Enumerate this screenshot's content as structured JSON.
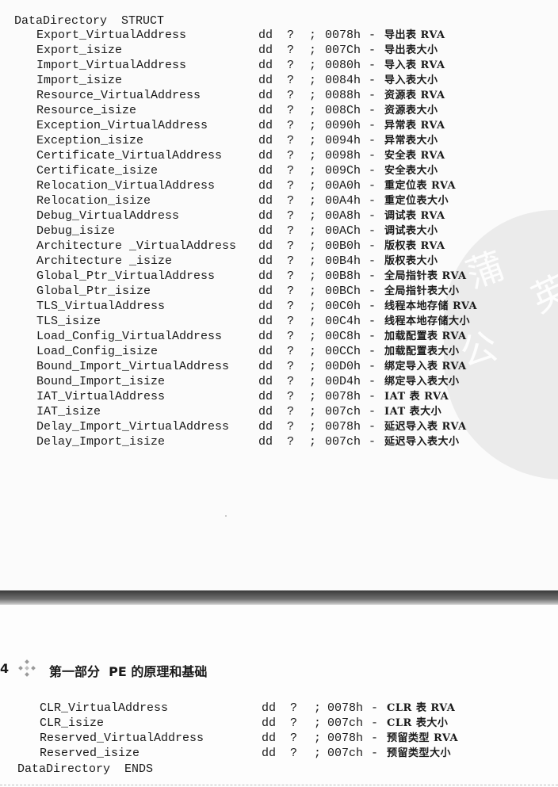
{
  "top_block": {
    "struct_open": "DataDirectory  STRUCT",
    "rows": [
      {
        "name": "Export_VirtualAddress",
        "type": "dd",
        "init": "?",
        "semi": ";",
        "offset": "0078h",
        "dash": "-",
        "comment": "导出表 RVA"
      },
      {
        "name": "Export_isize",
        "type": "dd",
        "init": "?",
        "semi": ";",
        "offset": "007Ch",
        "dash": "-",
        "comment": "导出表大小"
      },
      {
        "name": "Import_VirtualAddress",
        "type": "dd",
        "init": "?",
        "semi": ";",
        "offset": "0080h",
        "dash": "-",
        "comment": "导入表 RVA"
      },
      {
        "name": "Import_isize",
        "type": "dd",
        "init": "?",
        "semi": ";",
        "offset": "0084h",
        "dash": "-",
        "comment": "导入表大小"
      },
      {
        "name": "Resource_VirtualAddress",
        "type": "dd",
        "init": "?",
        "semi": ";",
        "offset": "0088h",
        "dash": "-",
        "comment": "资源表 RVA"
      },
      {
        "name": "Resource_isize",
        "type": "dd",
        "init": "?",
        "semi": ";",
        "offset": "008Ch",
        "dash": "-",
        "comment": "资源表大小"
      },
      {
        "name": "Exception_VirtualAddress",
        "type": "dd",
        "init": "?",
        "semi": ";",
        "offset": "0090h",
        "dash": "-",
        "comment": "异常表 RVA"
      },
      {
        "name": "Exception_isize",
        "type": "dd",
        "init": "?",
        "semi": ";",
        "offset": "0094h",
        "dash": "-",
        "comment": "异常表大小"
      },
      {
        "name": "Certificate_VirtualAddress",
        "type": "dd",
        "init": "?",
        "semi": ";",
        "offset": "0098h",
        "dash": "-",
        "comment": "安全表 RVA"
      },
      {
        "name": "Certificate_isize",
        "type": "dd",
        "init": "?",
        "semi": ";",
        "offset": "009Ch",
        "dash": "-",
        "comment": "安全表大小"
      },
      {
        "name": "Relocation_VirtualAddress",
        "type": "dd",
        "init": "?",
        "semi": ";",
        "offset": "00A0h",
        "dash": "-",
        "comment": "重定位表 RVA"
      },
      {
        "name": "Relocation_isize",
        "type": "dd",
        "init": "?",
        "semi": ";",
        "offset": "00A4h",
        "dash": "-",
        "comment": "重定位表大小"
      },
      {
        "name": "Debug_VirtualAddress",
        "type": "dd",
        "init": "?",
        "semi": ";",
        "offset": "00A8h",
        "dash": "-",
        "comment": "调试表 RVA"
      },
      {
        "name": "Debug_isize",
        "type": "dd",
        "init": "?",
        "semi": ";",
        "offset": "00ACh",
        "dash": "-",
        "comment": "调试表大小"
      },
      {
        "name": "Architecture _VirtualAddress",
        "type": "dd",
        "init": "?",
        "semi": ";",
        "offset": "00B0h",
        "dash": "-",
        "comment": "版权表 RVA"
      },
      {
        "name": "Architecture _isize",
        "type": "dd",
        "init": "?",
        "semi": ";",
        "offset": "00B4h",
        "dash": "-",
        "comment": "版权表大小"
      },
      {
        "name": "Global_Ptr_VirtualAddress",
        "type": "dd",
        "init": "?",
        "semi": ";",
        "offset": "00B8h",
        "dash": "-",
        "comment": "全局指针表 RVA"
      },
      {
        "name": "Global_Ptr_isize",
        "type": "dd",
        "init": "?",
        "semi": ";",
        "offset": "00BCh",
        "dash": "-",
        "comment": "全局指针表大小"
      },
      {
        "name": "TLS_VirtualAddress",
        "type": "dd",
        "init": "?",
        "semi": ";",
        "offset": "00C0h",
        "dash": "-",
        "comment": "线程本地存储 RVA"
      },
      {
        "name": "TLS_isize",
        "type": "dd",
        "init": "?",
        "semi": ";",
        "offset": "00C4h",
        "dash": "-",
        "comment": "线程本地存储大小"
      },
      {
        "name": "Load_Config_VirtualAddress",
        "type": "dd",
        "init": "?",
        "semi": ";",
        "offset": "00C8h",
        "dash": "-",
        "comment": "加载配置表 RVA"
      },
      {
        "name": "Load_Config_isize",
        "type": "dd",
        "init": "?",
        "semi": ";",
        "offset": "00CCh",
        "dash": "-",
        "comment": "加载配置表大小"
      },
      {
        "name": "Bound_Import_VirtualAddress",
        "type": "dd",
        "init": "?",
        "semi": ";",
        "offset": "00D0h",
        "dash": "-",
        "comment": "绑定导入表 RVA"
      },
      {
        "name": "Bound_Import_isize",
        "type": "dd",
        "init": "?",
        "semi": ";",
        "offset": "00D4h",
        "dash": "-",
        "comment": "绑定导入表大小"
      },
      {
        "name": "IAT_VirtualAddress",
        "type": "dd",
        "init": "?",
        "semi": ";",
        "offset": "0078h",
        "dash": "-",
        "comment": "IAT 表 RVA"
      },
      {
        "name": "IAT_isize",
        "type": "dd",
        "init": "?",
        "semi": ";",
        "offset": "007ch",
        "dash": "-",
        "comment": "IAT 表大小"
      },
      {
        "name": "Delay_Import_VirtualAddress",
        "type": "dd",
        "init": "?",
        "semi": ";",
        "offset": "0078h",
        "dash": "-",
        "comment": "延迟导入表 RVA"
      },
      {
        "name": "Delay_Import_isize",
        "type": "dd",
        "init": "?",
        "semi": ";",
        "offset": "007ch",
        "dash": "-",
        "comment": "延迟导入表大小"
      }
    ]
  },
  "page_header": {
    "page_number": "4",
    "chapter_title": "第一部分  PE 的原理和基础"
  },
  "bottom_block": {
    "rows": [
      {
        "name": "CLR_VirtualAddress",
        "type": "dd",
        "init": "?",
        "semi": ";",
        "offset": "0078h",
        "dash": "-",
        "comment": "CLR 表 RVA"
      },
      {
        "name": "CLR_isize",
        "type": "dd",
        "init": "?",
        "semi": ";",
        "offset": "007ch",
        "dash": "-",
        "comment": "CLR 表大小"
      },
      {
        "name": "Reserved_VirtualAddress",
        "type": "dd",
        "init": "?",
        "semi": ";",
        "offset": "0078h",
        "dash": "-",
        "comment": "预留类型 RVA"
      },
      {
        "name": "Reserved_isize",
        "type": "dd",
        "init": "?",
        "semi": ";",
        "offset": "007ch",
        "dash": "-",
        "comment": "预留类型大小"
      }
    ],
    "struct_close": "DataDirectory  ENDS"
  },
  "watermark": {
    "glyphs": [
      "蒲",
      "公",
      "英"
    ]
  }
}
